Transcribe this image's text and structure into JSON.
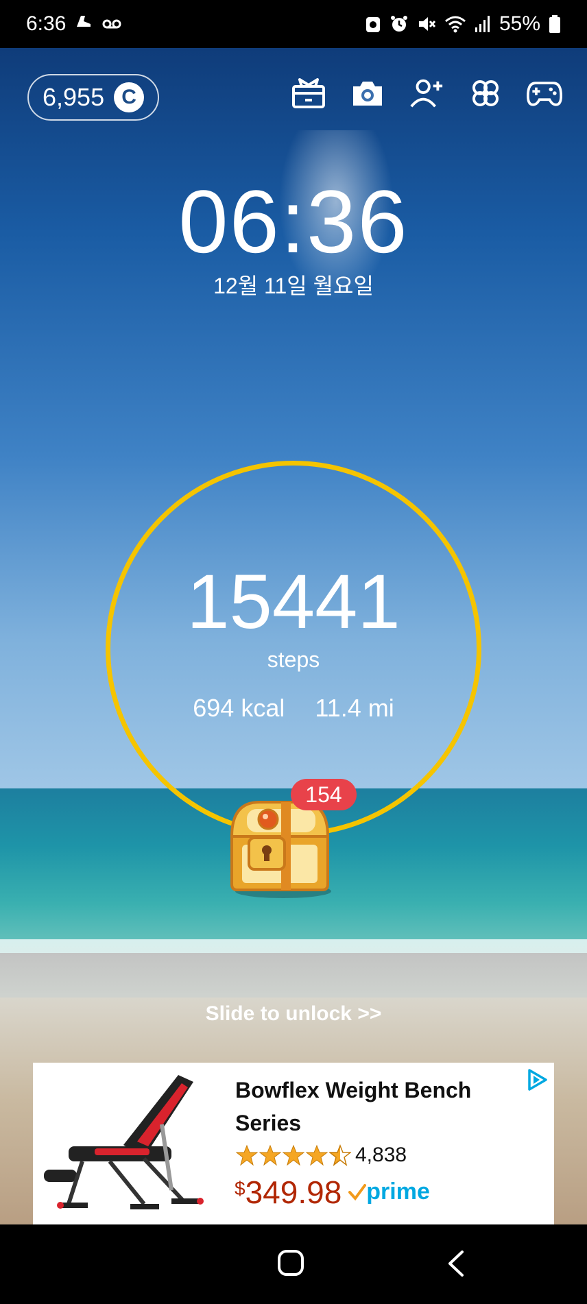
{
  "status_bar": {
    "time": "6:36",
    "battery": "55%"
  },
  "coins": {
    "amount": "6,955",
    "symbol": "C"
  },
  "clock": {
    "time": "06:36",
    "date": "12월 11일 월요일"
  },
  "steps": {
    "count": "15441",
    "label": "steps",
    "calories": "694 kcal",
    "distance": "11.4 mi"
  },
  "chest": {
    "badge": "154"
  },
  "unlock": {
    "label": "Slide to unlock >>"
  },
  "ad": {
    "title": "Bowflex Weight Bench Series",
    "rating_count": "4,838",
    "rating": 4.5,
    "currency": "$",
    "price": "349.98",
    "prime_label": "prime"
  },
  "colors": {
    "ring": "#f5c400",
    "badge": "#e8424a",
    "price": "#b12704",
    "prime": "#00a8e1",
    "star": "#f5a623"
  }
}
